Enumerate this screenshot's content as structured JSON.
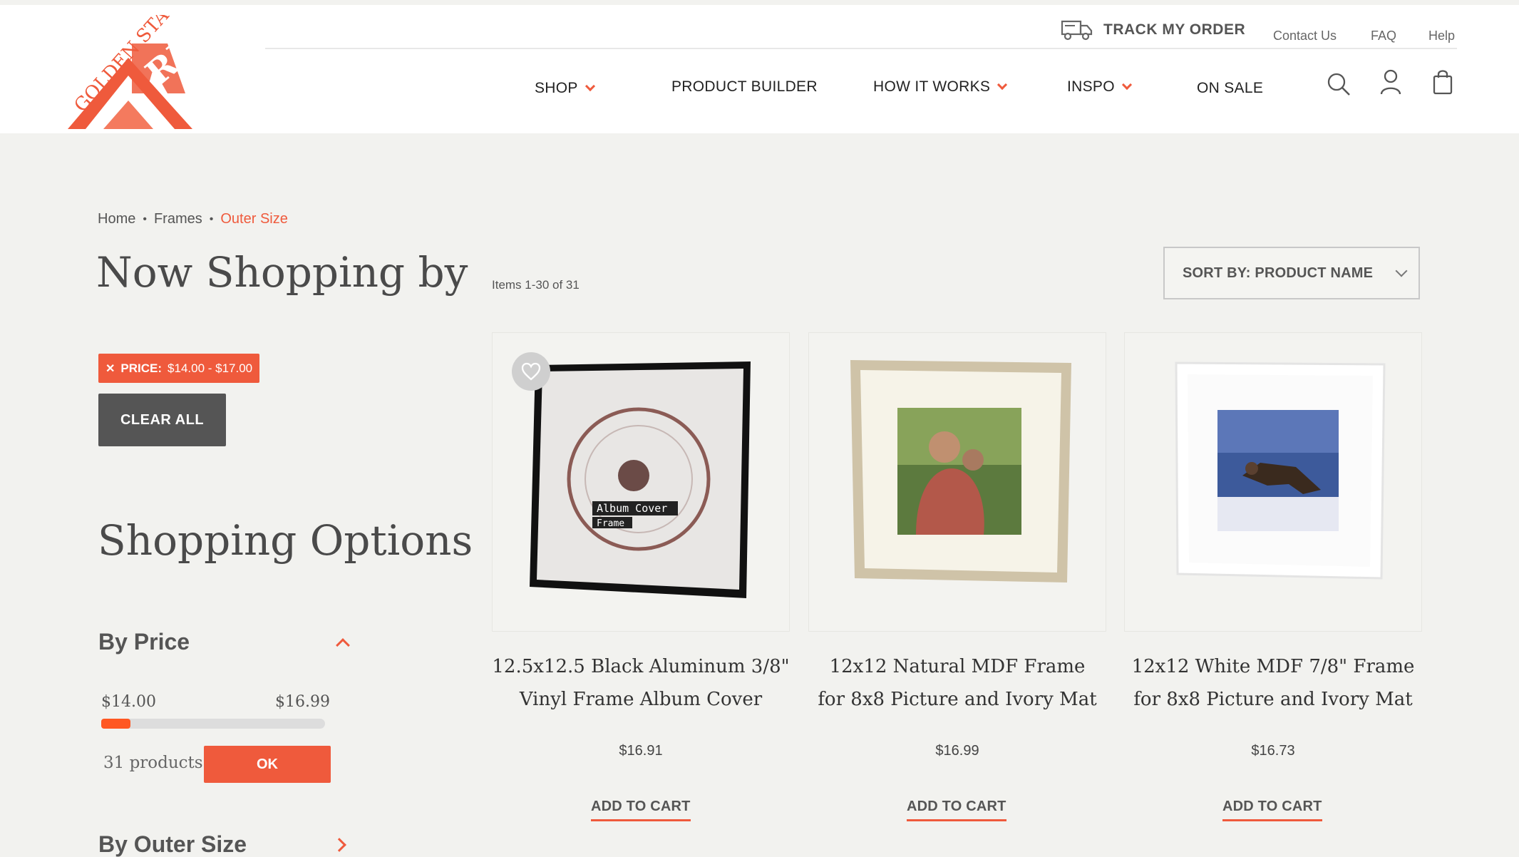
{
  "header": {
    "logo_text": "GOLDEN STATE TRI",
    "track_order": "TRACK MY ORDER",
    "contact": "Contact Us",
    "faq": "FAQ",
    "help": "Help",
    "nav": {
      "shop": "SHOP",
      "builder": "PRODUCT BUILDER",
      "how": "HOW IT WORKS",
      "inspo": "INSPO",
      "sale": "ON SALE"
    },
    "brand_color": "#ef5a3c"
  },
  "breadcrumb": {
    "home": "Home",
    "frames": "Frames",
    "current": "Outer Size"
  },
  "sidebar": {
    "title": "Now Shopping by",
    "chip_label": "PRICE:",
    "chip_range": "$14.00 - $17.00",
    "clear_all": "CLEAR ALL",
    "options_title": "Shopping Options",
    "by_price": "By Price",
    "price_min": "$14.00",
    "price_max": "$16.99",
    "slider_fill_fraction": 0.13,
    "count": "31 products",
    "ok": "OK",
    "by_outer_size": "By Outer Size"
  },
  "toolbar": {
    "items": "Items 1-30 of 31",
    "sort": "SORT BY: PRODUCT NAME"
  },
  "products": [
    {
      "line1": "12.5x12.5 Black Aluminum 3/8\"",
      "line2": "Vinyl Frame Album Cover",
      "price": "$16.91",
      "cta": "ADD TO CART",
      "art_text_1": "Album Cover",
      "art_text_2": "Frame"
    },
    {
      "line1": "12x12 Natural MDF Frame",
      "line2": "for 8x8 Picture and Ivory Mat",
      "price": "$16.99",
      "cta": "ADD TO CART"
    },
    {
      "line1": "12x12 White MDF 7/8\" Frame",
      "line2": "for 8x8 Picture and Ivory Mat",
      "price": "$16.73",
      "cta": "ADD TO CART"
    }
  ]
}
